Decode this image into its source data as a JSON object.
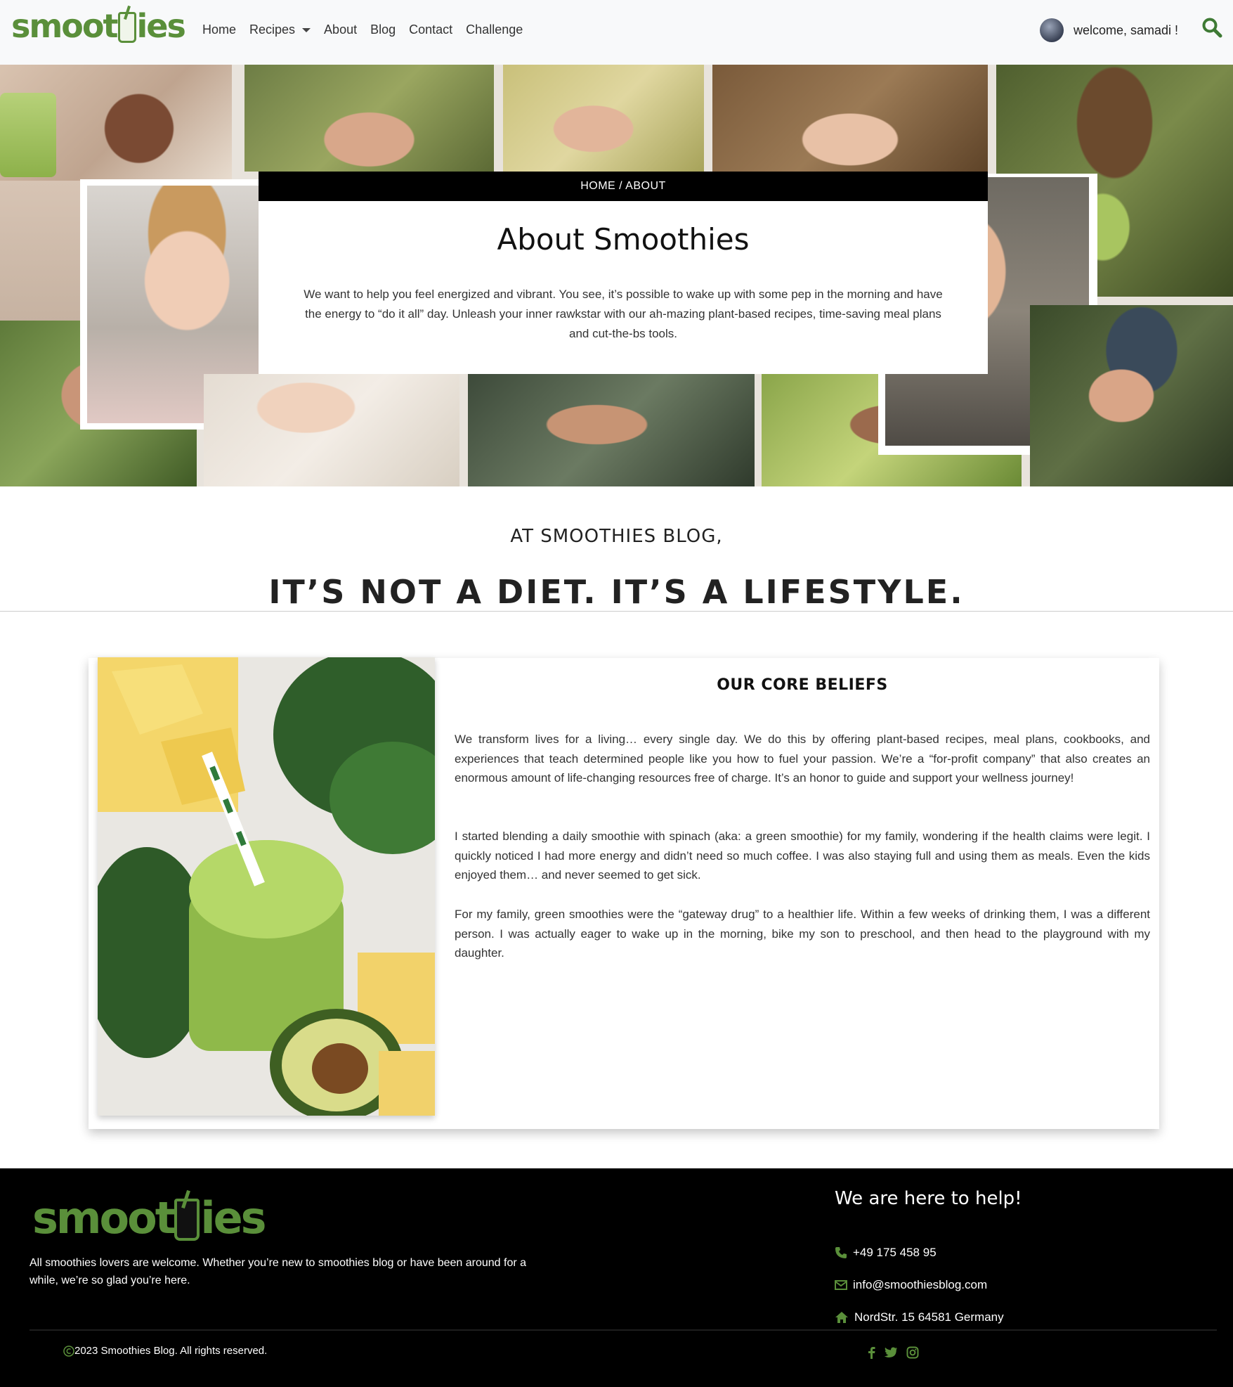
{
  "navbar": {
    "logo_text_left": "smoot",
    "logo_text_right": "ies",
    "links": [
      {
        "label": "Home"
      },
      {
        "label": "Recipes"
      },
      {
        "label": "About"
      },
      {
        "label": "Blog"
      },
      {
        "label": "Contact"
      },
      {
        "label": "Challenge"
      }
    ],
    "welcome_text": "welcome, samadi !",
    "search_icon": "search-icon",
    "accent_color": "#5a8f3a"
  },
  "hero": {
    "breadcrumb": "HOME / ABOUT",
    "title": "About Smoothies",
    "text": "We want to help you feel energized and vibrant. You see, it’s possible to wake up with some pep in the morning and have the energy to “do it all” day. Unleash your inner rawkstar with our ah-mazing plant-based recipes, time-saving meal plans and cut-the-bs tools."
  },
  "tagline": {
    "sub": "AT SMOOTHIES BLOG,",
    "main": "IT’S NOT A DIET. IT’S A LIFESTYLE."
  },
  "beliefs": {
    "title": "OUR CORE BELIEFS",
    "paragraphs": [
      "We transform lives for a living… every single day. We do this by offering plant-based recipes, meal plans, cookbooks, and experiences that teach determined people like you how to fuel your passion. We’re a “for-profit company” that also creates an enormous amount of life-changing resources free of charge. It’s an honor to guide and support your wellness journey!",
      "I started blending a daily smoothie with spinach (aka: a green smoothie) for my family, wondering if the health claims were legit. I quickly noticed I had more energy and didn’t need so much coffee. I was also staying full and using them as meals. Even the kids enjoyed them… and never seemed to get sick.",
      "For my family, green smoothies were the “gateway drug” to a healthier life. Within a few weeks of drinking them, I was a different person. I was actually eager to wake up in the morning, bike my son to preschool, and then head to the playground with my daughter."
    ]
  },
  "footer": {
    "logo_text_left": "smoot",
    "logo_text_right": "ies",
    "about": "All smoothies lovers are welcome. Whether you’re new to smoothies blog or have been around for a while, we’re so glad you’re here.",
    "help_title": "We are here to help!",
    "phone": "+49 175 458 95",
    "email": "info@smoothiesblog.com",
    "address": "NordStr. 15 64581 Germany",
    "copyright": "2023 Smoothies Blog. All rights reserved.",
    "social": [
      "facebook-icon",
      "twitter-icon",
      "instagram-icon"
    ]
  }
}
